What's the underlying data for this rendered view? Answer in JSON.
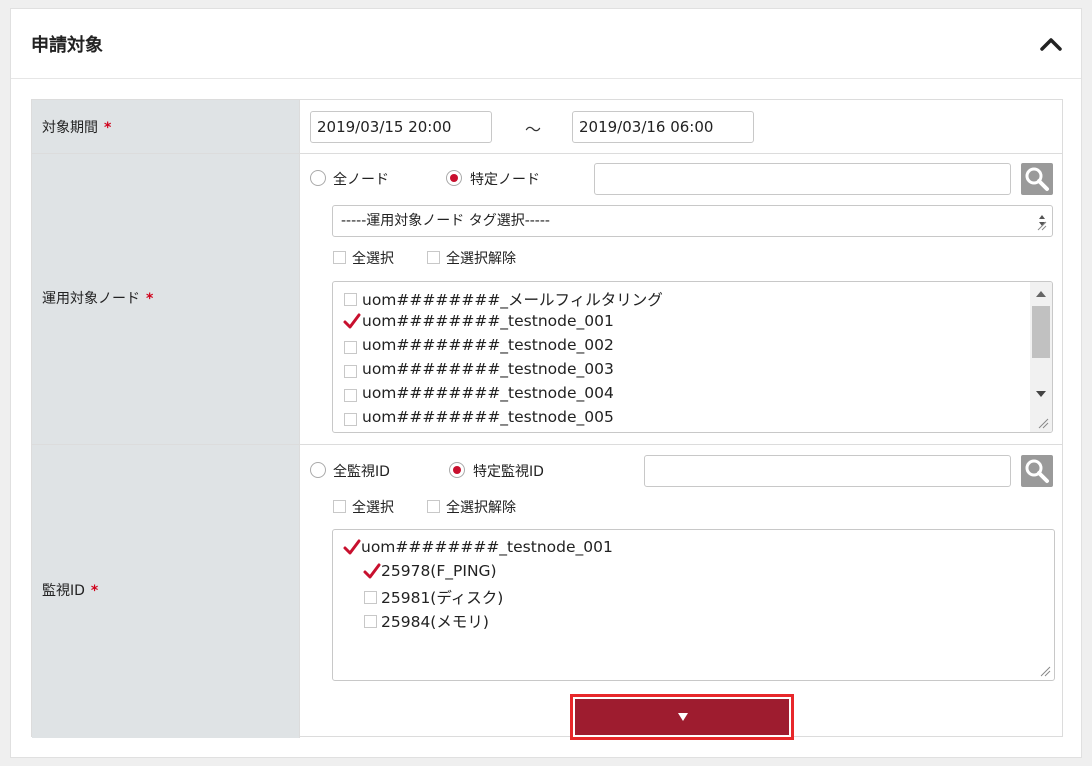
{
  "panel": {
    "title": "申請対象"
  },
  "period": {
    "label": "対象期間",
    "required": "*",
    "start": "2019/03/15 20:00",
    "separator": "～",
    "end": "2019/03/16 06:00"
  },
  "nodes": {
    "label": "運用対象ノード",
    "required": "*",
    "radio_all": "全ノード",
    "radio_specific": "特定ノード",
    "selected_radio": "特定ノード",
    "search_value": "",
    "tag_select": "-----運用対象ノード タグ選択-----",
    "select_all": "全選択",
    "deselect_all": "全選択解除",
    "items": [
      {
        "label": "uom########_メールフィルタリング",
        "checked": false
      },
      {
        "label": "uom########_testnode_001",
        "checked": true
      },
      {
        "label": "uom########_testnode_002",
        "checked": false
      },
      {
        "label": "uom########_testnode_003",
        "checked": false
      },
      {
        "label": "uom########_testnode_004",
        "checked": false
      },
      {
        "label": "uom########_testnode_005",
        "checked": false
      }
    ]
  },
  "monitor": {
    "label": "監視ID",
    "required": "*",
    "radio_all": "全監視ID",
    "radio_specific": "特定監視ID",
    "selected_radio": "特定監視ID",
    "search_value": "",
    "select_all": "全選択",
    "deselect_all": "全選択解除",
    "tree": [
      {
        "label": "uom########_testnode_001",
        "checked": true,
        "level": 0
      },
      {
        "label": "25978(F_PING)",
        "checked": true,
        "level": 1
      },
      {
        "label": "25981(ディスク)",
        "checked": false,
        "level": 1
      },
      {
        "label": "25984(メモリ)",
        "checked": false,
        "level": 1
      }
    ]
  },
  "colors": {
    "accent": "#c8102e",
    "label_bg": "#dfe3e5",
    "expand_button": "#9e1c2f",
    "highlight_border": "#e8282b"
  },
  "icons": {
    "collapse": "chevron-up-icon",
    "search": "magnifier-icon",
    "expand": "triangle-down-icon"
  }
}
